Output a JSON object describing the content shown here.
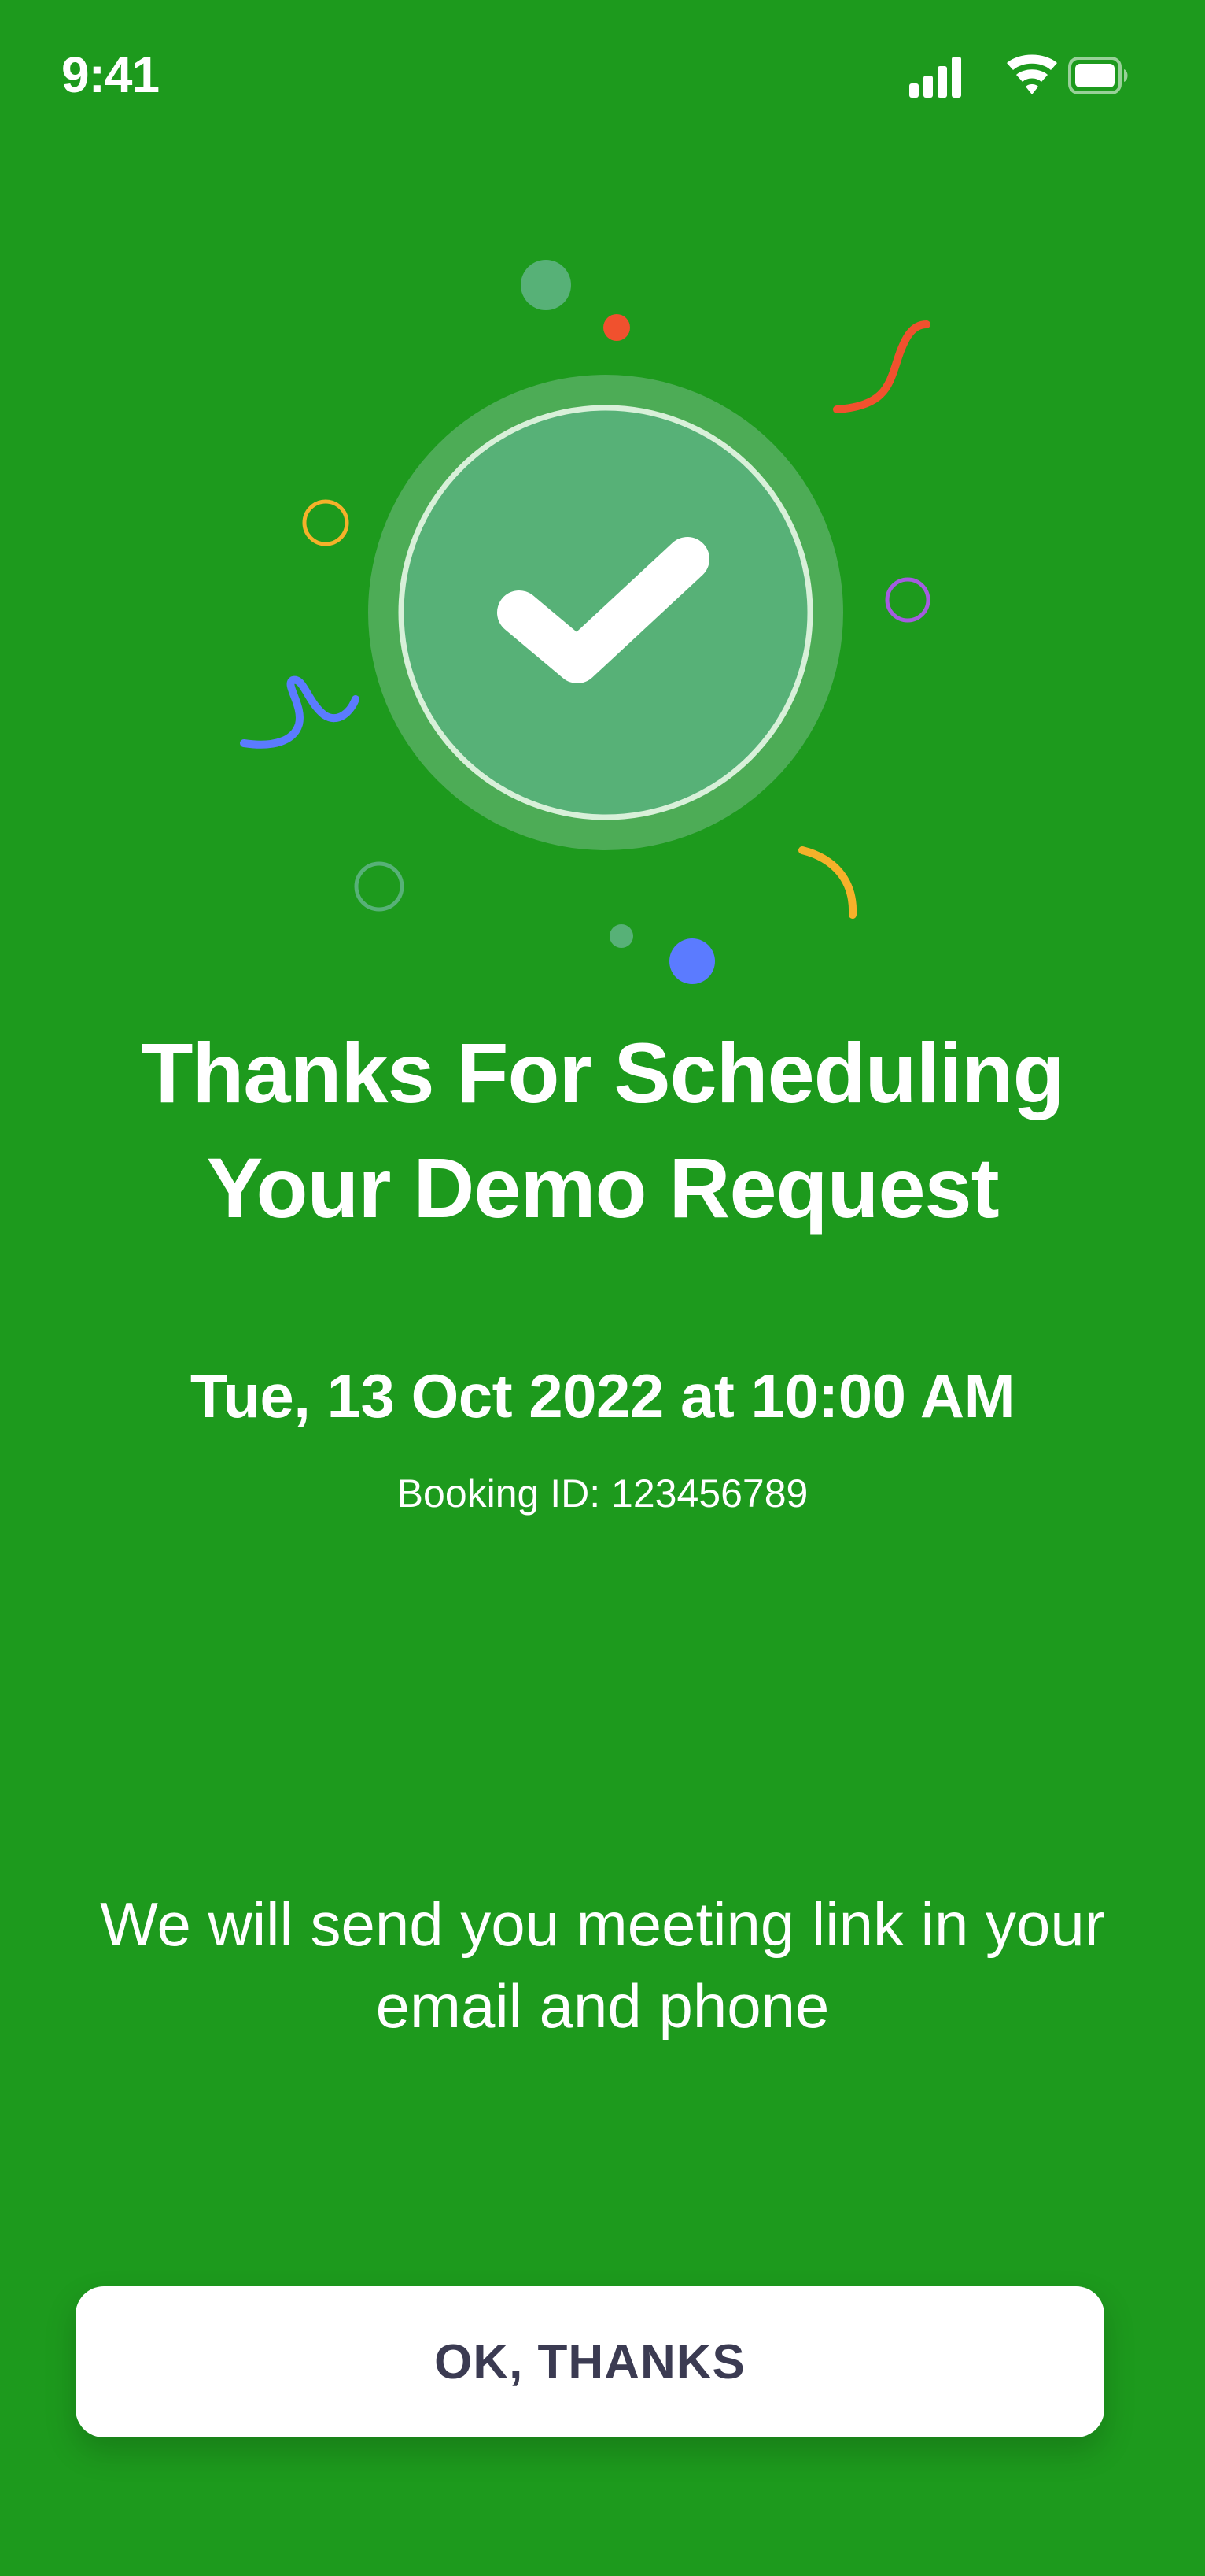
{
  "status_bar": {
    "time": "9:41"
  },
  "icons": {
    "signal": "cellular-signal-icon",
    "wifi": "wifi-icon",
    "battery": "battery-icon",
    "success": "checkmark-circle-icon"
  },
  "colors": {
    "background": "#1d9a1d",
    "button_text": "#3b3b52",
    "check_circle": "#57b177",
    "confetti_red": "#f0512e",
    "confetti_orange": "#f5b12a",
    "confetti_purple": "#a45ce0",
    "confetti_blue": "#5b7bff"
  },
  "confirmation": {
    "headline_line1": "Thanks For Scheduling",
    "headline_line2": "Your Demo Request",
    "datetime": "Tue, 13 Oct 2022 at 10:00 AM",
    "booking_id": "Booking ID: 123456789",
    "info_line1": "We will send you meeting link in your",
    "info_line2": "email and phone"
  },
  "actions": {
    "ok_label": "OK, THANKS"
  }
}
